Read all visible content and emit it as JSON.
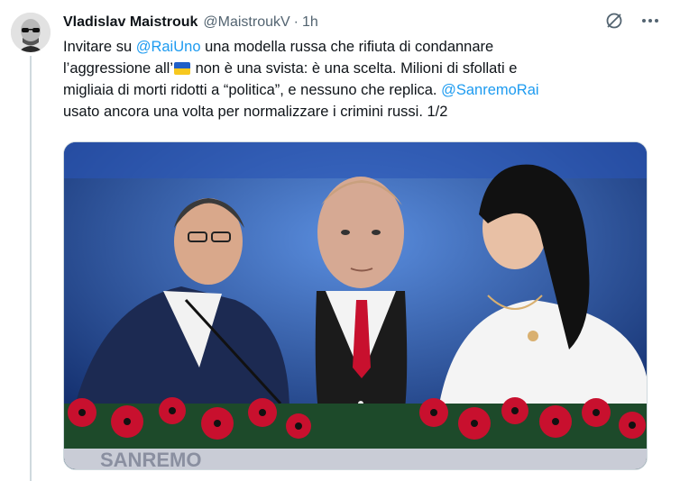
{
  "author": {
    "name": "Vladislav Maistrouk",
    "handle": "@MaistroukV",
    "separator": "·",
    "time": "1h"
  },
  "icons": {
    "grok": "grok-icon",
    "more": "more-options-icon"
  },
  "text": {
    "p1": "Invitare su ",
    "m1": "@RaiUno",
    "p2": "  una modella russa che rifiuta di condannare",
    "p3": "l’aggressione all’",
    "p4": " non è una svista: è una scelta. Milioni di sfollati e",
    "p5": "migliaia di morti ridotti a “politica”, e nessuno che replica. ",
    "m2": "@SanremoRai",
    "p6": "usato ancora una volta per normalizzare i crimini russi. 1/2"
  },
  "media": {
    "stage_text": "SANREMO"
  },
  "colors": {
    "link": "#1d9bf0",
    "secondary": "#536471",
    "stage_blue": "#1a3f8f"
  }
}
